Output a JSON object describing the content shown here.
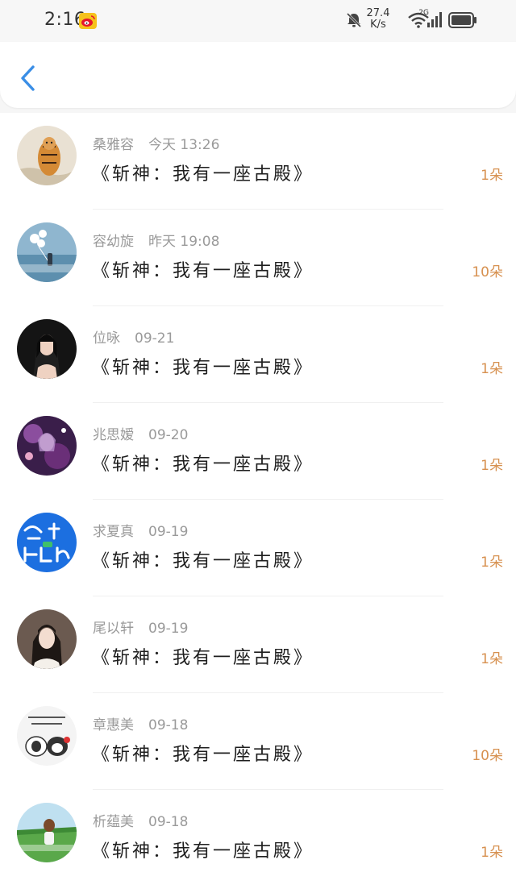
{
  "status_bar": {
    "time": "2:16",
    "net_speed_value": "27.4",
    "net_speed_unit": "K/s",
    "signal_label": "2G",
    "icons": [
      "weibo-icon",
      "bell-muted-icon",
      "wifi-icon",
      "signal-icon",
      "battery-icon"
    ]
  },
  "header": {
    "back_icon": "chevron-left-icon",
    "accent": "#3a8ee6"
  },
  "colors": {
    "count": "#d79150",
    "meta": "#9a9a9a"
  },
  "records": [
    {
      "name": "桑雅容",
      "time": "今天 13:26",
      "title": "《斩神：我有一座古殿》",
      "count": "1朵"
    },
    {
      "name": "容幼旋",
      "time": "昨天 19:08",
      "title": "《斩神：我有一座古殿》",
      "count": "10朵"
    },
    {
      "name": "位咏",
      "time": "09-21",
      "title": "《斩神：我有一座古殿》",
      "count": "1朵"
    },
    {
      "name": "兆思嫒",
      "time": "09-20",
      "title": "《斩神：我有一座古殿》",
      "count": "1朵"
    },
    {
      "name": "求夏真",
      "time": "09-19",
      "title": "《斩神：我有一座古殿》",
      "count": "1朵"
    },
    {
      "name": "尾以轩",
      "time": "09-19",
      "title": "《斩神：我有一座古殿》",
      "count": "1朵"
    },
    {
      "name": "章惠美",
      "time": "09-18",
      "title": "《斩神：我有一座古殿》",
      "count": "10朵"
    },
    {
      "name": "析蕴美",
      "time": "09-18",
      "title": "《斩神：我有一座古殿》",
      "count": "1朵"
    }
  ]
}
